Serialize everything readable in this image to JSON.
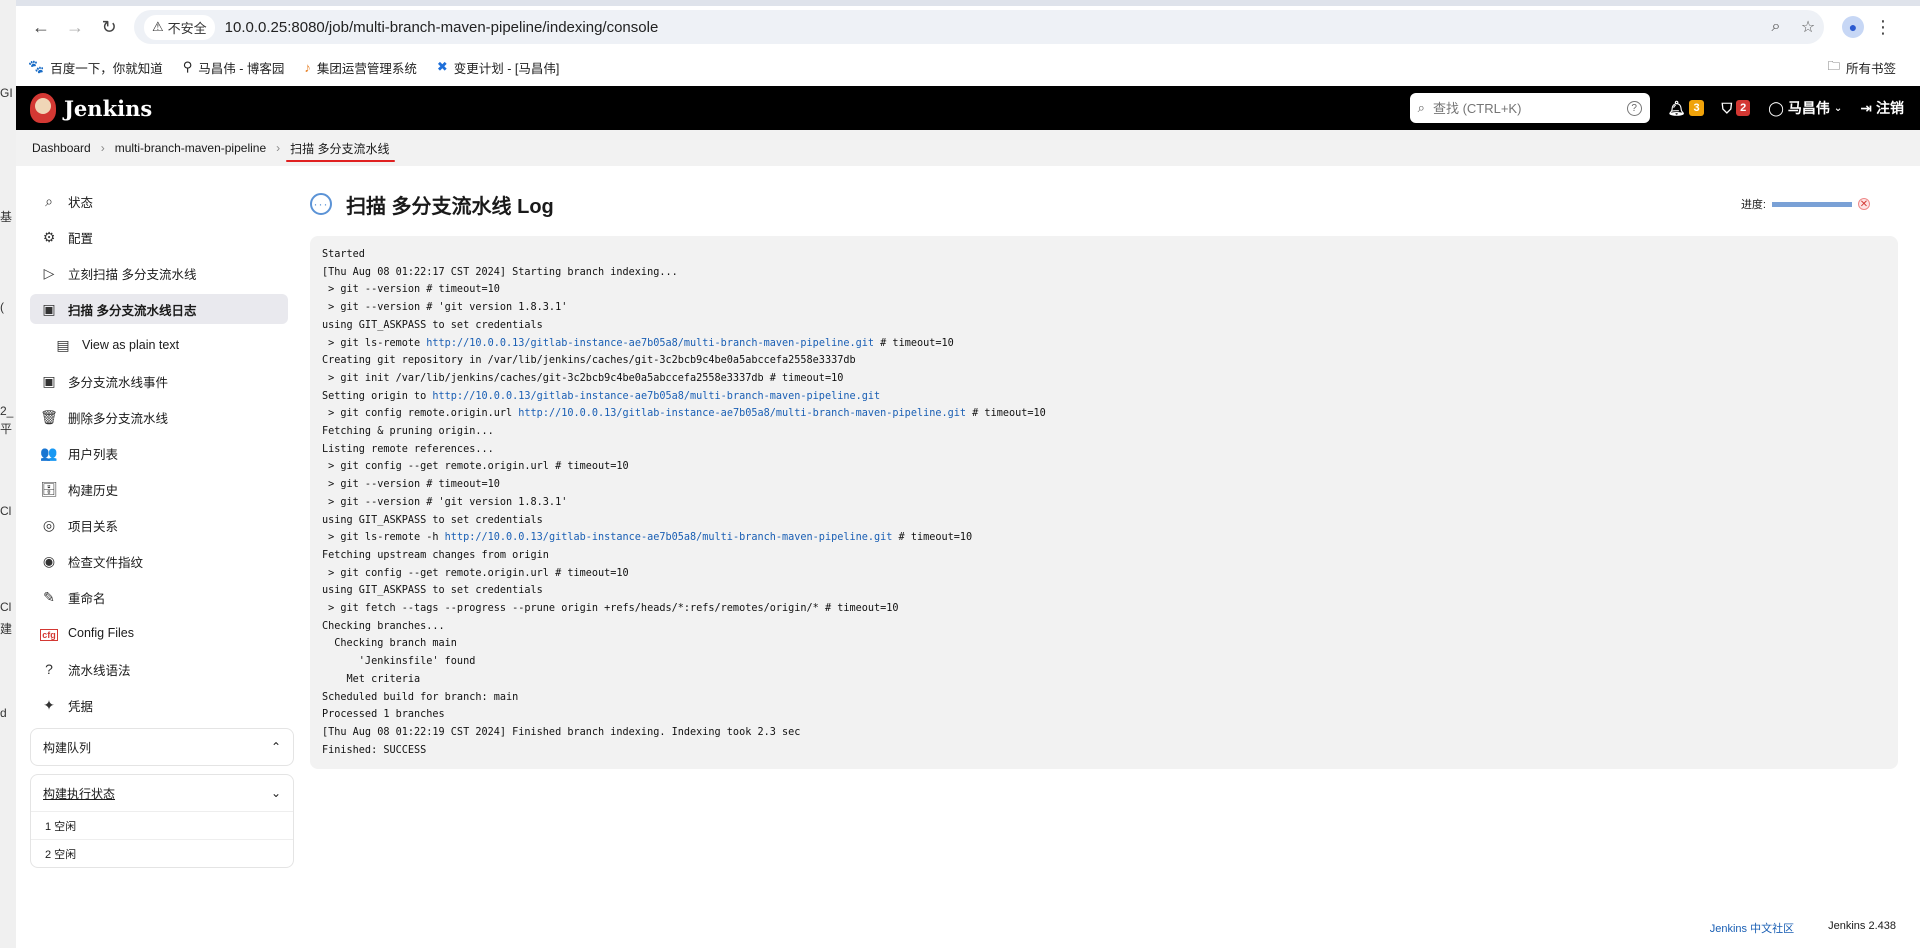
{
  "browser": {
    "insecure_label": "不安全",
    "url": "10.0.0.25:8080/job/multi-branch-maven-pipeline/indexing/console",
    "bookmarks": [
      "百度一下，你就知道",
      "马昌伟 - 博客园",
      "集团运营管理系统",
      "变更计划 - [马昌伟]"
    ],
    "all_bookmarks": "所有书签"
  },
  "desktop_strip": [
    "GI",
    "基",
    "(",
    "2_",
    "平",
    "Cl",
    "Cl",
    "建",
    "d"
  ],
  "header": {
    "logo": "Jenkins",
    "search_placeholder": "查找 (CTRL+K)",
    "notifications_count": "3",
    "security_count": "2",
    "user": "马昌伟",
    "logout": "注销"
  },
  "breadcrumb": [
    "Dashboard",
    "multi-branch-maven-pipeline",
    "扫描 多分支流水线"
  ],
  "sidebar": {
    "tasks": [
      {
        "label": "状态",
        "icon": "search-icon",
        "glyph": "⌕"
      },
      {
        "label": "配置",
        "icon": "gear-icon",
        "glyph": "⚙"
      },
      {
        "label": "立刻扫描 多分支流水线",
        "icon": "play-icon",
        "glyph": "▷"
      },
      {
        "label": "扫描 多分支流水线日志",
        "icon": "terminal-icon",
        "glyph": "▣"
      },
      {
        "label": "View as plain text",
        "icon": "document-icon",
        "glyph": "▤"
      },
      {
        "label": "多分支流水线事件",
        "icon": "terminal-icon",
        "glyph": "▣"
      },
      {
        "label": "删除多分支流水线",
        "icon": "trash-icon",
        "glyph": "🗑"
      },
      {
        "label": "用户列表",
        "icon": "people-icon",
        "glyph": "👥"
      },
      {
        "label": "构建历史",
        "icon": "inbox-icon",
        "glyph": "🗄"
      },
      {
        "label": "项目关系",
        "icon": "relations-icon",
        "glyph": "◎"
      },
      {
        "label": "检查文件指纹",
        "icon": "fingerprint-icon",
        "glyph": "◉"
      },
      {
        "label": "重命名",
        "icon": "pencil-icon",
        "glyph": "✎"
      },
      {
        "label": "Config Files",
        "icon": "cfg-icon",
        "glyph": "cfg"
      },
      {
        "label": "流水线语法",
        "icon": "help-icon",
        "glyph": "?"
      },
      {
        "label": "凭据",
        "icon": "credentials-icon",
        "glyph": "✦"
      }
    ],
    "build_queue_title": "构建队列",
    "executor_title": "构建执行状态",
    "executors": [
      "1  空闲",
      "2  空闲"
    ]
  },
  "main": {
    "title": "扫描 多分支流水线 Log",
    "progress_label": "进度:",
    "progress_fraction": 1.0,
    "console": [
      {
        "t": "Started"
      },
      {
        "t": "[Thu Aug 08 01:22:17 CST 2024] Starting branch indexing..."
      },
      {
        "t": " > git --version # timeout=10"
      },
      {
        "t": " > git --version # 'git version 1.8.3.1'"
      },
      {
        "t": "using GIT_ASKPASS to set credentials"
      },
      {
        "t": " > git ls-remote ",
        "link": "http://10.0.0.13/gitlab-instance-ae7b05a8/multi-branch-maven-pipeline.git",
        "after": " # timeout=10"
      },
      {
        "t": "Creating git repository in /var/lib/jenkins/caches/git-3c2bcb9c4be0a5abccefa2558e3337db"
      },
      {
        "t": " > git init /var/lib/jenkins/caches/git-3c2bcb9c4be0a5abccefa2558e3337db # timeout=10"
      },
      {
        "t": "Setting origin to ",
        "link": "http://10.0.0.13/gitlab-instance-ae7b05a8/multi-branch-maven-pipeline.git"
      },
      {
        "t": " > git config remote.origin.url ",
        "link": "http://10.0.0.13/gitlab-instance-ae7b05a8/multi-branch-maven-pipeline.git",
        "after": " # timeout=10"
      },
      {
        "t": "Fetching & pruning origin..."
      },
      {
        "t": "Listing remote references..."
      },
      {
        "t": " > git config --get remote.origin.url # timeout=10"
      },
      {
        "t": " > git --version # timeout=10"
      },
      {
        "t": " > git --version # 'git version 1.8.3.1'"
      },
      {
        "t": "using GIT_ASKPASS to set credentials"
      },
      {
        "t": " > git ls-remote -h ",
        "link": "http://10.0.0.13/gitlab-instance-ae7b05a8/multi-branch-maven-pipeline.git",
        "after": " # timeout=10"
      },
      {
        "t": "Fetching upstream changes from origin"
      },
      {
        "t": " > git config --get remote.origin.url # timeout=10"
      },
      {
        "t": "using GIT_ASKPASS to set credentials"
      },
      {
        "t": " > git fetch --tags --progress --prune origin +refs/heads/*:refs/remotes/origin/* # timeout=10"
      },
      {
        "t": "Checking branches..."
      },
      {
        "t": "  Checking branch main"
      },
      {
        "t": "      'Jenkinsfile' found"
      },
      {
        "t": "    Met criteria"
      },
      {
        "t": "Scheduled build for branch: main"
      },
      {
        "t": "Processed 1 branches"
      },
      {
        "t": "[Thu Aug 08 01:22:19 CST 2024] Finished branch indexing. Indexing took 2.3 sec"
      },
      {
        "t": "Finished: SUCCESS"
      }
    ]
  },
  "footer": {
    "community": "Jenkins 中文社区",
    "version": "Jenkins 2.438"
  }
}
